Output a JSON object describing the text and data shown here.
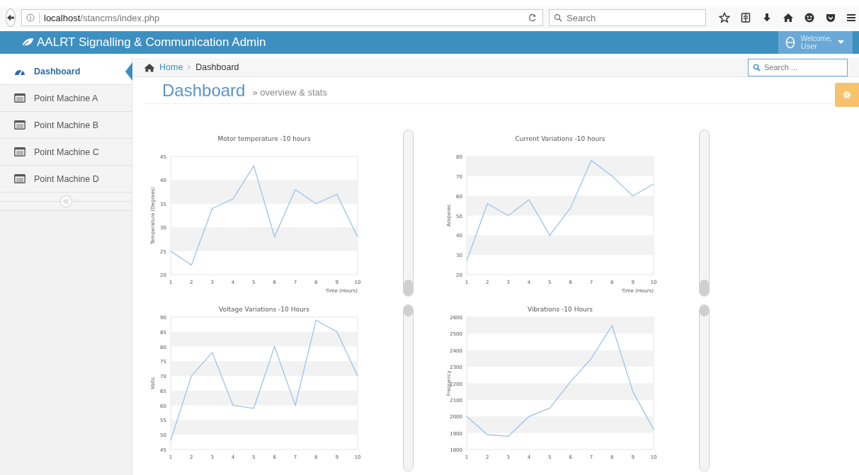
{
  "browser": {
    "url_host": "localhost",
    "url_path": "/stancms/index.php",
    "search": {
      "placeholder": "Search"
    }
  },
  "header": {
    "title": "AALRT Signalling & Communication Admin",
    "user": {
      "greeting": "Welcome,",
      "name": "User"
    }
  },
  "sidebar": {
    "items": [
      {
        "label": "Dashboard",
        "kind": "dashboard",
        "selected": true
      },
      {
        "label": "Point Machine A",
        "kind": "list",
        "selected": false
      },
      {
        "label": "Point Machine B",
        "kind": "list",
        "selected": false
      },
      {
        "label": "Point Machine C",
        "kind": "list",
        "selected": false
      },
      {
        "label": "Point Machine D",
        "kind": "list",
        "selected": false
      }
    ]
  },
  "breadcrumb": {
    "items": [
      "Home",
      "Dashboard"
    ],
    "search": {
      "placeholder": "Search ..."
    }
  },
  "page": {
    "title": "Dashboard",
    "subtitle": "» overview & stats"
  },
  "charts": [
    {
      "chart_data": {
        "type": "line",
        "title": "Motor temperature -10 hours",
        "xlabel": "Time (Hours)",
        "ylabel": "Temperature (Degrees)",
        "x": [
          1,
          2,
          3,
          4,
          5,
          6,
          7,
          8,
          9,
          10
        ],
        "xlim": [
          1,
          10
        ],
        "ylim": [
          20,
          45
        ],
        "yticks": [
          20,
          25,
          30,
          35,
          40,
          45
        ],
        "xticks": [
          1,
          2,
          3,
          4,
          5,
          6,
          7,
          8,
          9,
          10
        ],
        "series": [
          {
            "color": "#9fc3e8",
            "values": [
              25,
              22,
              34,
              36,
              43,
              28,
              38,
              35,
              37,
              28
            ]
          }
        ]
      }
    },
    {
      "chart_data": {
        "type": "line",
        "title": "Current Variations -10 hours",
        "xlabel": "Time (Hours)",
        "ylabel": "Amperes",
        "x": [
          1,
          2,
          3,
          4,
          5,
          6,
          7,
          8,
          9,
          10
        ],
        "xlim": [
          1,
          10
        ],
        "ylim": [
          20,
          80
        ],
        "yticks": [
          20,
          30,
          40,
          50,
          60,
          70,
          80
        ],
        "xticks": [
          1,
          2,
          3,
          4,
          5,
          6,
          7,
          8,
          9,
          10
        ],
        "series": [
          {
            "color": "#9fc3e8",
            "values": [
              27,
              56,
              50,
              58,
              40,
              54,
              78,
              70,
              60,
              66
            ]
          }
        ]
      }
    },
    {
      "chart_data": {
        "type": "line",
        "title": "Voltage Variations -10 Hours",
        "ylabel": "Volts",
        "x": [
          1,
          2,
          3,
          4,
          5,
          6,
          7,
          8,
          9,
          10
        ],
        "xlim": [
          1,
          10
        ],
        "ylim": [
          45,
          90
        ],
        "yticks": [
          45,
          50,
          55,
          60,
          65,
          70,
          75,
          80,
          85,
          90
        ],
        "xticks": [
          1,
          2,
          3,
          4,
          5,
          6,
          7,
          8,
          9,
          10
        ],
        "series": [
          {
            "color": "#9fc3e8",
            "values": [
              48,
              70,
              78,
              60,
              59,
              80,
              60,
              89,
              85,
              70
            ]
          }
        ]
      }
    },
    {
      "chart_data": {
        "type": "line",
        "title": "Vibrations -10 Hours",
        "ylabel": "Frequency",
        "x": [
          1,
          2,
          3,
          4,
          5,
          6,
          7,
          8,
          9,
          10
        ],
        "xlim": [
          1,
          10
        ],
        "ylim": [
          1800,
          2600
        ],
        "yticks": [
          1800,
          1900,
          2000,
          2100,
          2200,
          2300,
          2400,
          2500,
          2600
        ],
        "xticks": [
          1,
          2,
          3,
          4,
          5,
          6,
          7,
          8,
          9,
          10
        ],
        "series": [
          {
            "color": "#9fc3e8",
            "values": [
              2000,
              1890,
              1880,
              2000,
              2050,
              2210,
              2350,
              2550,
              2150,
              1920
            ]
          }
        ]
      }
    }
  ]
}
